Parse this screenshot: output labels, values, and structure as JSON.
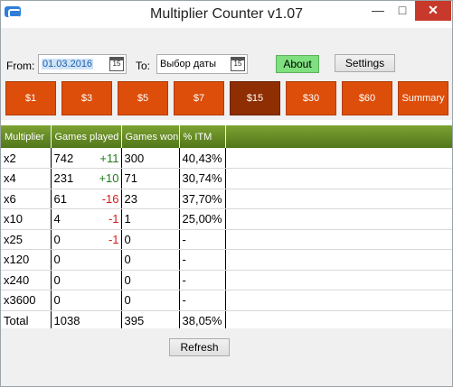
{
  "window": {
    "title": "Multiplier Counter v1.07",
    "controls": {
      "minimize": "—",
      "maximize": "□",
      "close": "✕"
    }
  },
  "filters": {
    "from_label": "From:",
    "from_value": "01.03.2016",
    "to_label": "To:",
    "to_value": "Выбор даты",
    "calendar_day": "15",
    "about_label": "About",
    "settings_label": "Settings"
  },
  "stakes": [
    {
      "label": "$1",
      "active": false
    },
    {
      "label": "$3",
      "active": false
    },
    {
      "label": "$5",
      "active": false
    },
    {
      "label": "$7",
      "active": false
    },
    {
      "label": "$15",
      "active": true
    },
    {
      "label": "$30",
      "active": false
    },
    {
      "label": "$60",
      "active": false
    },
    {
      "label": "Summary",
      "active": false
    }
  ],
  "table": {
    "headers": [
      "Multiplier",
      "Games played",
      "Games won",
      "% ITM"
    ],
    "rows": [
      {
        "multiplier": "x2",
        "games": "742",
        "delta": "+11",
        "won": "300",
        "itm": "40,43%"
      },
      {
        "multiplier": "x4",
        "games": "231",
        "delta": "+10",
        "won": "71",
        "itm": "30,74%"
      },
      {
        "multiplier": "x6",
        "games": "61",
        "delta": "-16",
        "won": "23",
        "itm": "37,70%"
      },
      {
        "multiplier": "x10",
        "games": "4",
        "delta": "-1",
        "won": "1",
        "itm": "25,00%"
      },
      {
        "multiplier": "x25",
        "games": "0",
        "delta": "-1",
        "won": "0",
        "itm": "-"
      },
      {
        "multiplier": "x120",
        "games": "0",
        "delta": "",
        "won": "0",
        "itm": "-"
      },
      {
        "multiplier": "x240",
        "games": "0",
        "delta": "",
        "won": "0",
        "itm": "-"
      },
      {
        "multiplier": "x3600",
        "games": "0",
        "delta": "",
        "won": "0",
        "itm": "-"
      },
      {
        "multiplier": "Total",
        "games": "1038",
        "delta": "",
        "won": "395",
        "itm": "38,05%"
      }
    ]
  },
  "refresh_label": "Refresh",
  "colors": {
    "stake_button": "#dc4e0a",
    "stake_button_active": "#8e2e02",
    "header_green": "#6a8f27",
    "about_green": "#7ee07e",
    "delta_positive": "#1f7a1f",
    "delta_negative": "#d91a1a",
    "close_red": "#c7392b"
  }
}
